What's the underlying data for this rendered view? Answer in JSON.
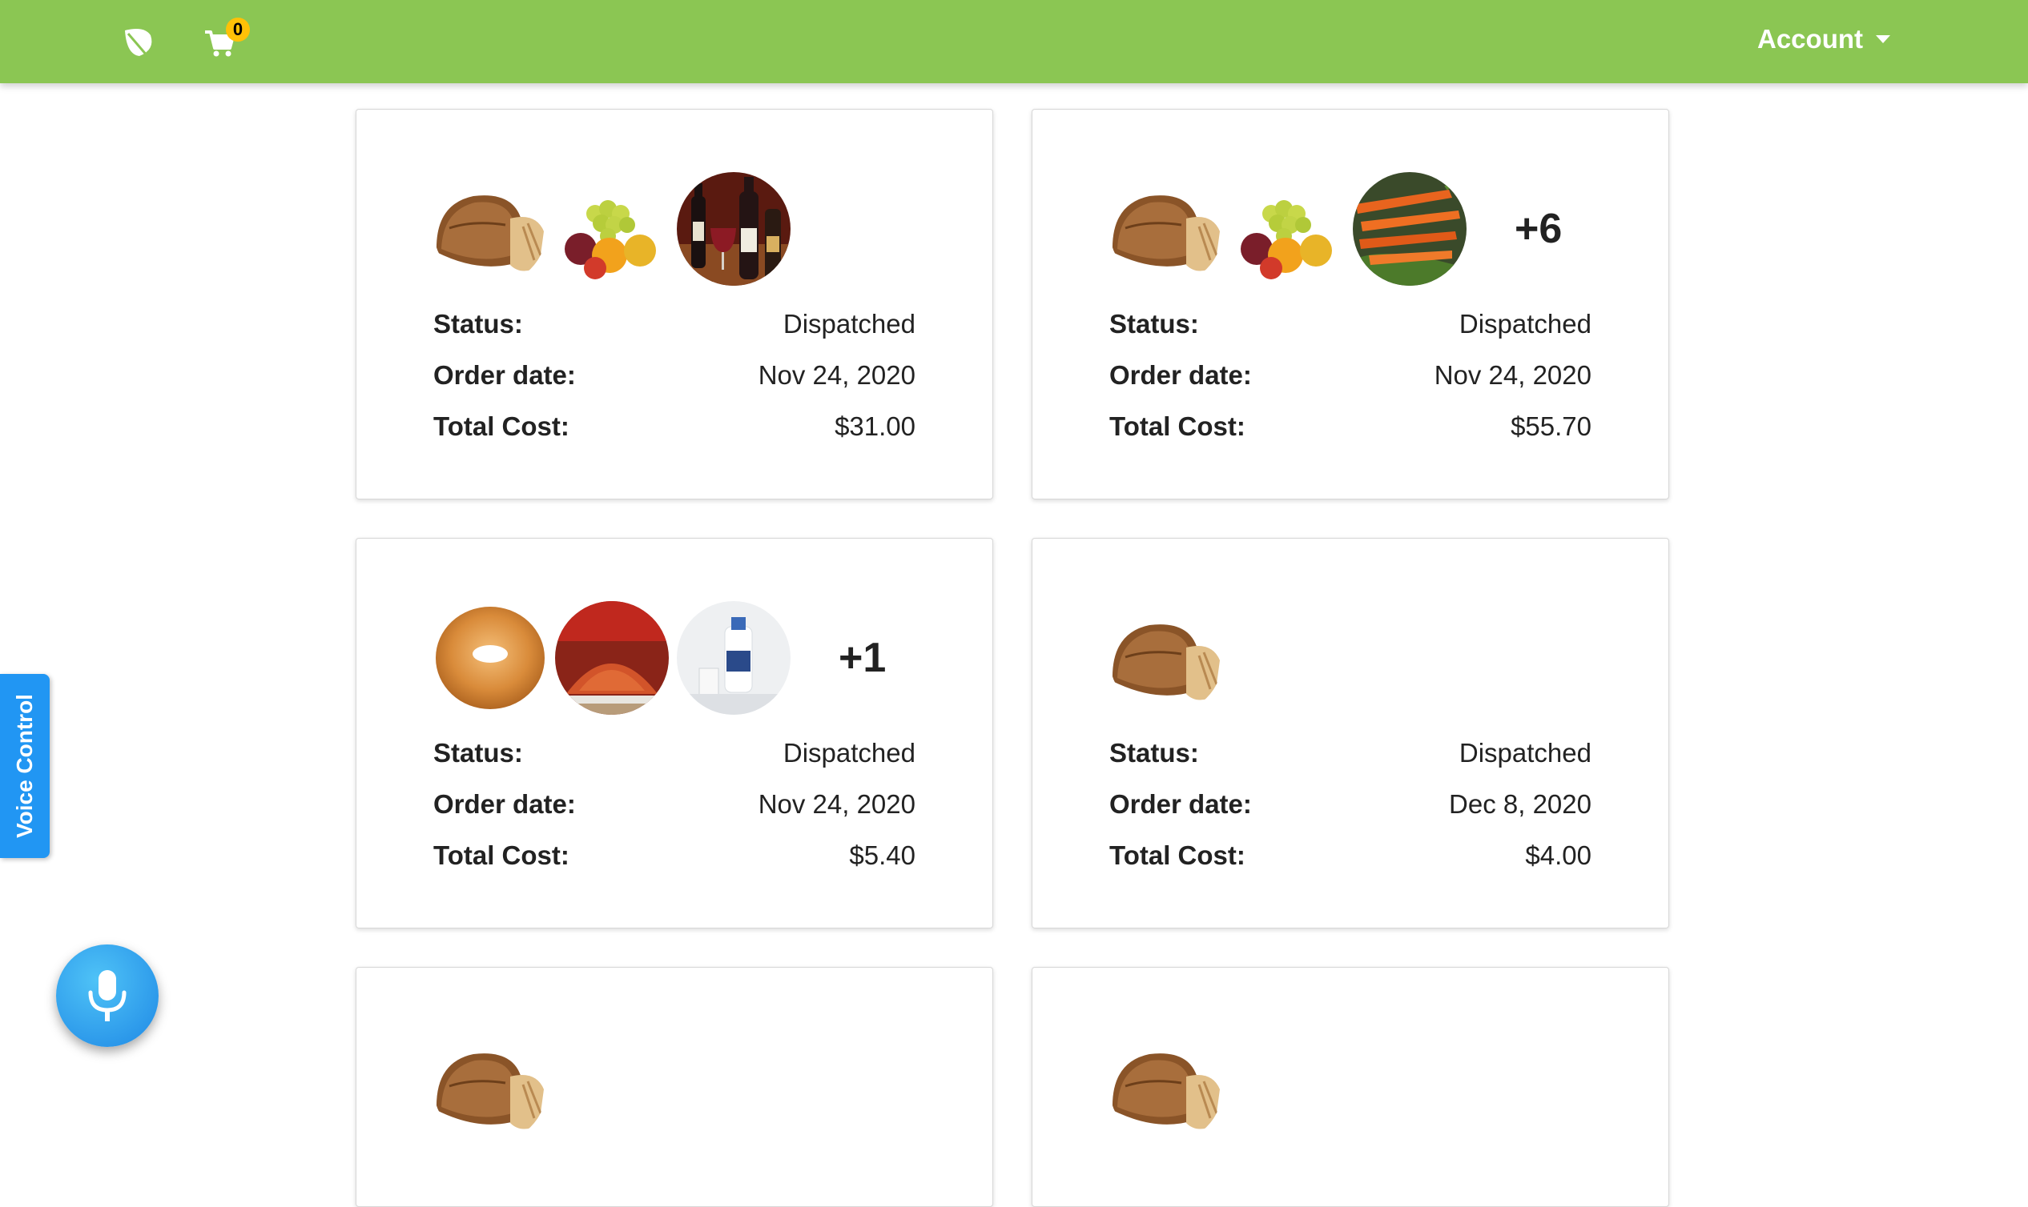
{
  "navbar": {
    "logo_icon": "leaf-icon",
    "cart_icon": "shopping-cart-icon",
    "cart_count": "0",
    "account_label": "Account",
    "background_color": "#8bc653",
    "badge_color": "#ffc107"
  },
  "orders": [
    {
      "items": [
        "bread",
        "fruit",
        "wine"
      ],
      "more": "",
      "status_label": "Status:",
      "status": "Dispatched",
      "date_label": "Order date:",
      "date": "Nov 24, 2020",
      "cost_label": "Total Cost:",
      "cost": "$31.00"
    },
    {
      "items": [
        "bread",
        "fruit",
        "carrots"
      ],
      "more": "+6",
      "status_label": "Status:",
      "status": "Dispatched",
      "date_label": "Order date:",
      "date": "Nov 24, 2020",
      "cost_label": "Total Cost:",
      "cost": "$55.70"
    },
    {
      "items": [
        "bagel",
        "paprika",
        "milk"
      ],
      "more": "+1",
      "status_label": "Status:",
      "status": "Dispatched",
      "date_label": "Order date:",
      "date": "Nov 24, 2020",
      "cost_label": "Total Cost:",
      "cost": "$5.40"
    },
    {
      "items": [
        "bread"
      ],
      "more": "",
      "status_label": "Status:",
      "status": "Dispatched",
      "date_label": "Order date:",
      "date": "Dec 8, 2020",
      "cost_label": "Total Cost:",
      "cost": "$4.00"
    },
    {
      "items": [
        "bread"
      ]
    },
    {
      "items": [
        "bread"
      ]
    }
  ],
  "voice_control": {
    "tab_label": "Voice Control",
    "mic_icon": "microphone-icon",
    "color": "#2196f3"
  }
}
